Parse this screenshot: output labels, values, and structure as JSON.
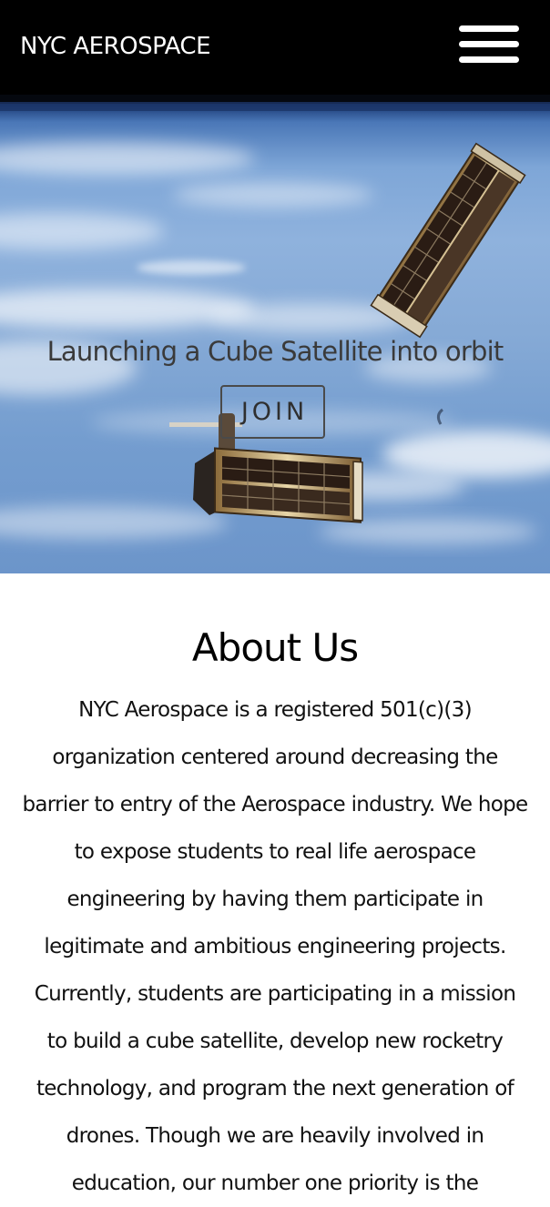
{
  "header": {
    "brand": "NYC AEROSPACE",
    "menu_icon": "hamburger-menu-icon"
  },
  "hero": {
    "tagline": "Launching a Cube Satellite into orbit",
    "join_label": "JOIN",
    "image": "cube-satellites-in-orbit-over-earth"
  },
  "about": {
    "title": "About Us",
    "lines": [
      "NYC Aerospace is a registered 501(c)(3)",
      "organization centered around decreasing the",
      "barrier to entry of the Aerospace industry. We hope",
      "to expose students to real life aerospace",
      "engineering by having them participate in",
      "legitimate and ambitious engineering projects.",
      "Currently, students are participating in a mission",
      "to build a cube satellite, develop new rocketry",
      "technology, and program the next generation of",
      "drones. Though we are heavily involved in",
      "education, our number one priority is the"
    ]
  },
  "colors": {
    "header_bg": "#000000",
    "header_text": "#ffffff",
    "hero_sky": "#86aad6",
    "page_bg": "#ffffff",
    "body_text": "#111111"
  }
}
